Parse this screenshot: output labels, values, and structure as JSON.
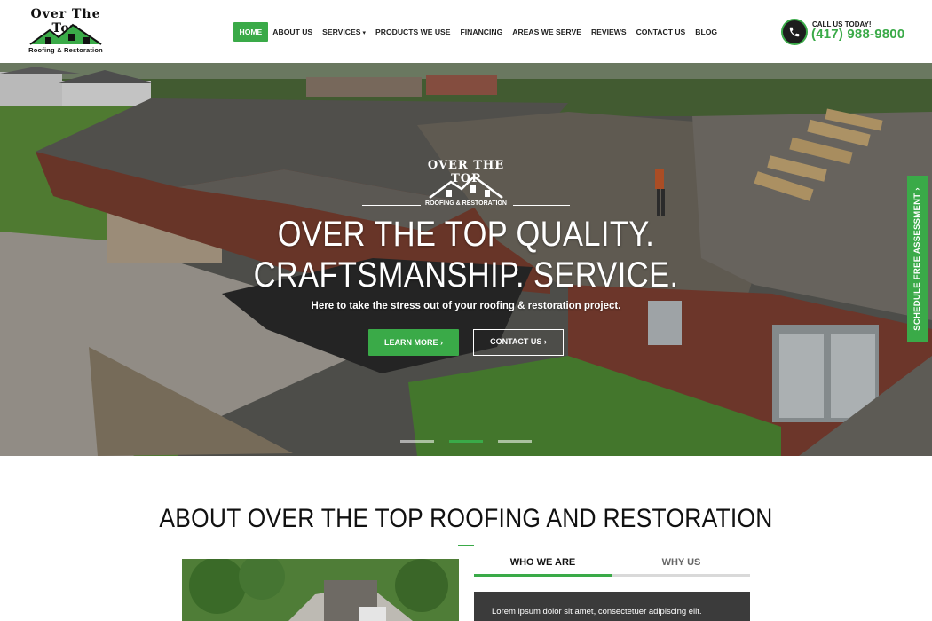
{
  "brand": {
    "top": "Over The Top",
    "bottom": "Roofing & Restoration"
  },
  "nav": {
    "items": [
      "HOME",
      "ABOUT US",
      "SERVICES",
      "PRODUCTS WE USE",
      "FINANCING",
      "AREAS WE SERVE",
      "REVIEWS",
      "CONTACT US",
      "BLOG"
    ]
  },
  "call": {
    "label": "CALL US TODAY!",
    "number": "(417) 988-9800"
  },
  "hero": {
    "logo_top": "OVER THE TOP",
    "logo_bottom": "ROOFING & RESTORATION",
    "title_line1": "OVER THE TOP QUALITY.",
    "title_line2": "CRAFTSMANSHIP. SERVICE.",
    "subtitle": "Here to take the stress out of your roofing & restoration project.",
    "btn_learn": "LEARN MORE ›",
    "btn_contact": "CONTACT US ›",
    "slides": 3,
    "active_slide": 2
  },
  "side_tab": {
    "label": "SCHEDULE FREE ASSESSMENT ›"
  },
  "about": {
    "title": "ABOUT OVER THE TOP ROOFING AND RESTORATION",
    "tab_who": "WHO WE ARE",
    "tab_why": "WHY US",
    "text": "Lorem ipsum dolor sit amet, consectetuer adipiscing elit."
  },
  "colors": {
    "accent": "#3aaa48",
    "dark": "#1d1d1d"
  },
  "icons": [
    "house-roof-icon",
    "phone-icon",
    "chevron-down-icon",
    "chevron-right-icon"
  ]
}
